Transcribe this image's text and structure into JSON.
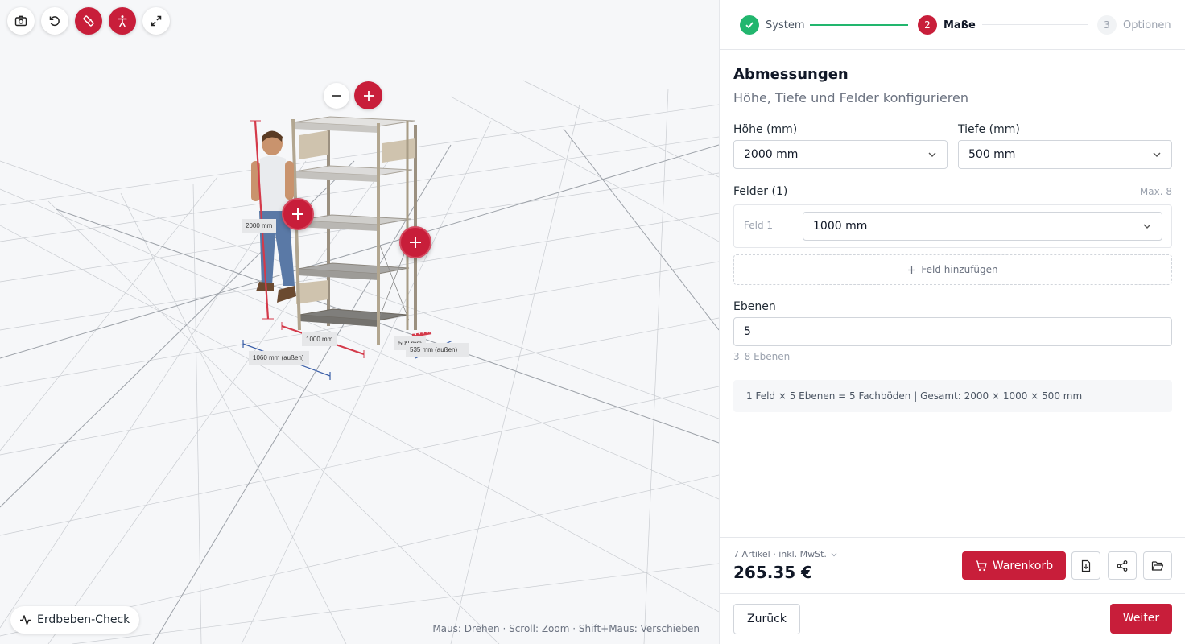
{
  "viewport": {
    "toolbar": [
      {
        "icon": "camera-icon",
        "active": false
      },
      {
        "icon": "reset-rotation-icon",
        "active": false
      },
      {
        "icon": "ruler-icon",
        "active": true
      },
      {
        "icon": "human-figure-icon",
        "active": true
      },
      {
        "icon": "fullscreen-icon",
        "active": false
      }
    ],
    "dimensions": {
      "height": "2000 mm",
      "width": "1000 mm",
      "width_outer": "1060 mm (außen)",
      "depth": "500 mm",
      "depth_outer": "535 mm (außen)"
    },
    "earthquake_button": "Erdbeben-Check",
    "controls_hint": "Maus: Drehen · Scroll: Zoom · Shift+Maus: Verschieben"
  },
  "steps": [
    {
      "number": "",
      "label": "System",
      "state": "done"
    },
    {
      "number": "2",
      "label": "Maße",
      "state": "current"
    },
    {
      "number": "3",
      "label": "Optionen",
      "state": "future"
    }
  ],
  "form": {
    "title": "Abmessungen",
    "subtitle": "Höhe, Tiefe und Felder konfigurieren",
    "height_label": "Höhe (mm)",
    "height_value": "2000 mm",
    "depth_label": "Tiefe (mm)",
    "depth_value": "500 mm",
    "fields_label": "Felder (1)",
    "fields_max": "Max. 8",
    "fields": [
      {
        "label": "Feld 1",
        "value": "1000 mm"
      }
    ],
    "add_field": "Feld hinzufügen",
    "levels_label": "Ebenen",
    "levels_value": "5",
    "levels_help": "3–8 Ebenen",
    "summary": "1 Feld × 5 Ebenen = 5 Fachböden | Gesamt: 2000 × 1000 × 500 mm"
  },
  "footer": {
    "item_count": "7 Artikel · inkl. MwSt.",
    "price": "265.35 €",
    "cart_button": "Warenkorb",
    "back_button": "Zurück",
    "next_button": "Weiter"
  },
  "colors": {
    "accent": "#c81e3a",
    "success": "#22b66e"
  }
}
